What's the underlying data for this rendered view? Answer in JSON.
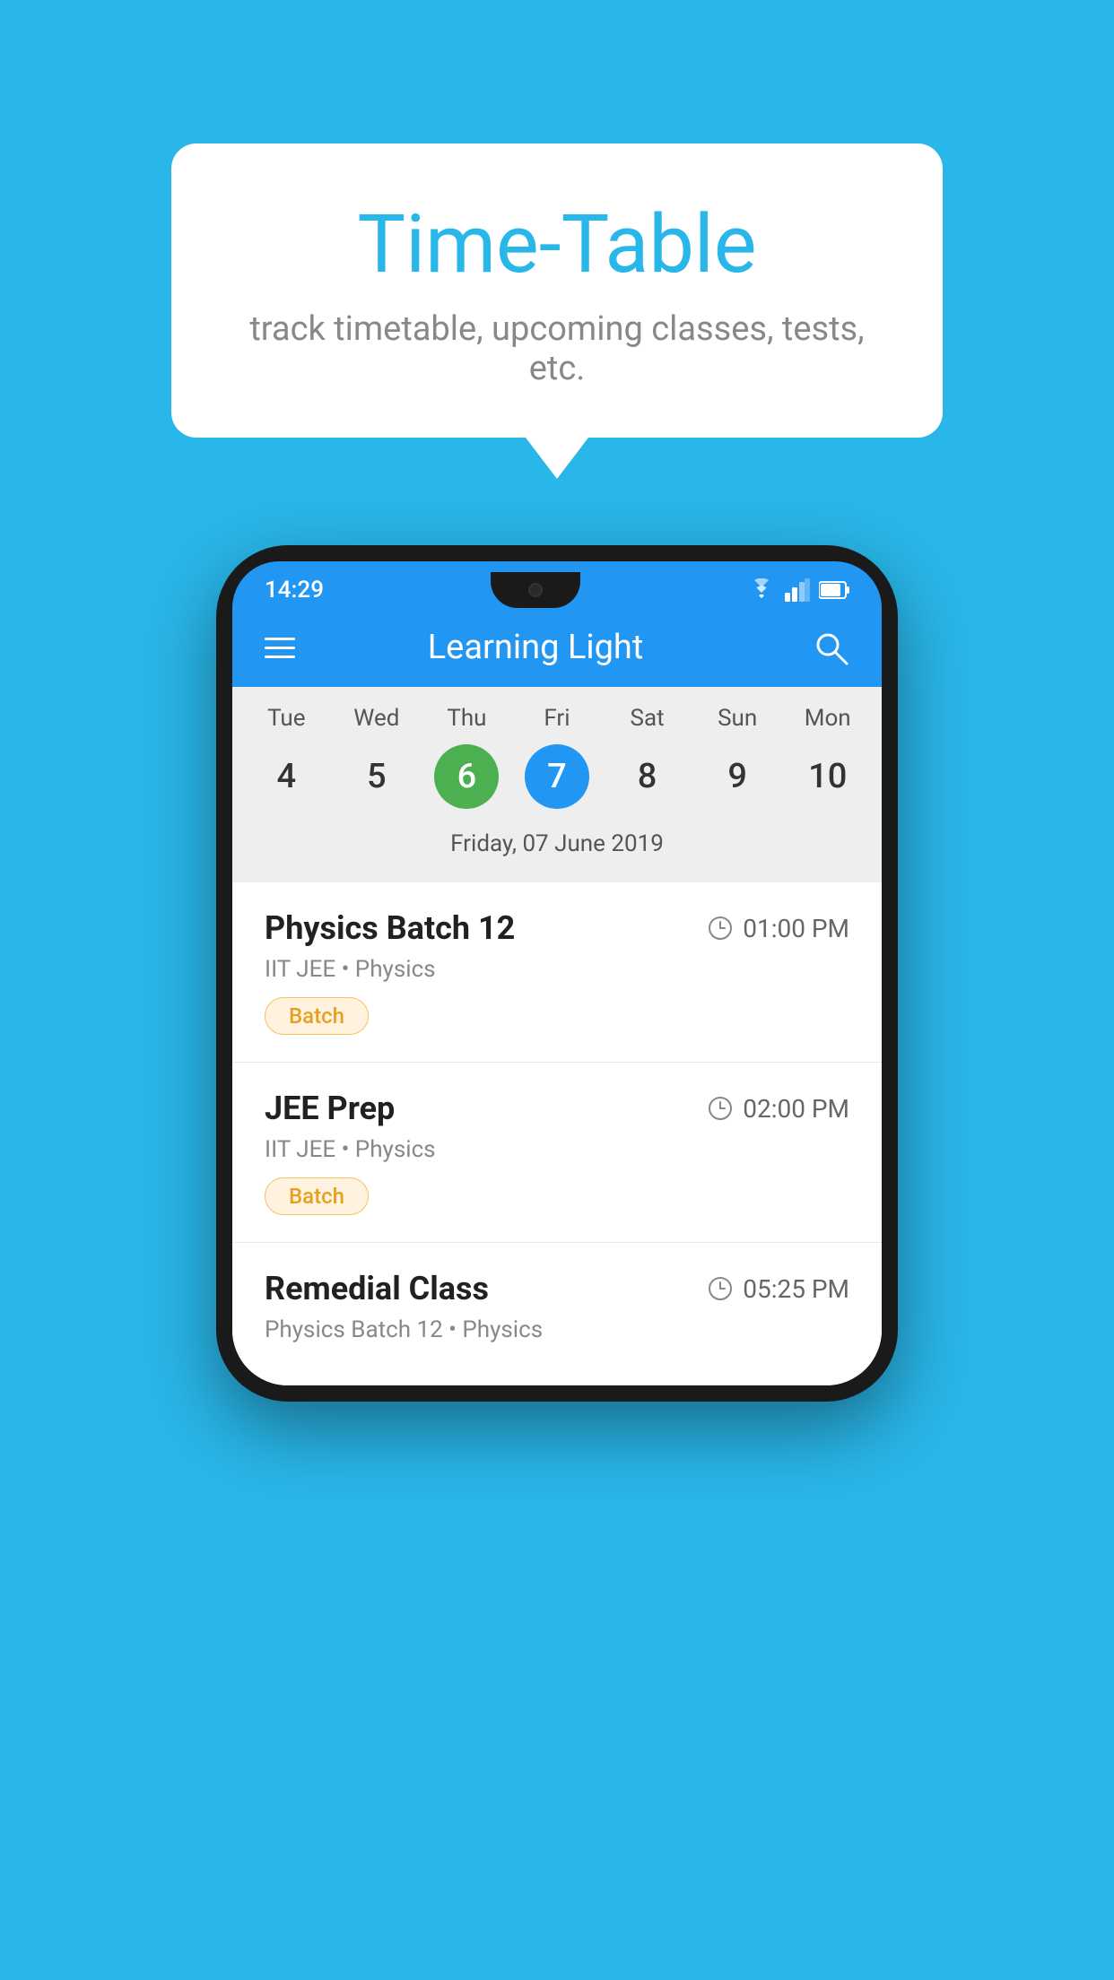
{
  "background_color": "#29b6e8",
  "hero": {
    "title": "Time-Table",
    "subtitle": "track timetable, upcoming classes, tests, etc."
  },
  "phone": {
    "status_time": "14:29",
    "app_name": "Learning Light",
    "calendar": {
      "days": [
        "Tue",
        "Wed",
        "Thu",
        "Fri",
        "Sat",
        "Sun",
        "Mon"
      ],
      "dates": [
        "4",
        "5",
        "6",
        "7",
        "8",
        "9",
        "10"
      ],
      "today_index": 2,
      "selected_index": 3,
      "selected_date_label": "Friday, 07 June 2019"
    },
    "schedule": [
      {
        "title": "Physics Batch 12",
        "time": "01:00 PM",
        "subtitle": "IIT JEE • Physics",
        "tag": "Batch"
      },
      {
        "title": "JEE Prep",
        "time": "02:00 PM",
        "subtitle": "IIT JEE • Physics",
        "tag": "Batch"
      },
      {
        "title": "Remedial Class",
        "time": "05:25 PM",
        "subtitle": "Physics Batch 12 • Physics",
        "tag": ""
      }
    ]
  }
}
